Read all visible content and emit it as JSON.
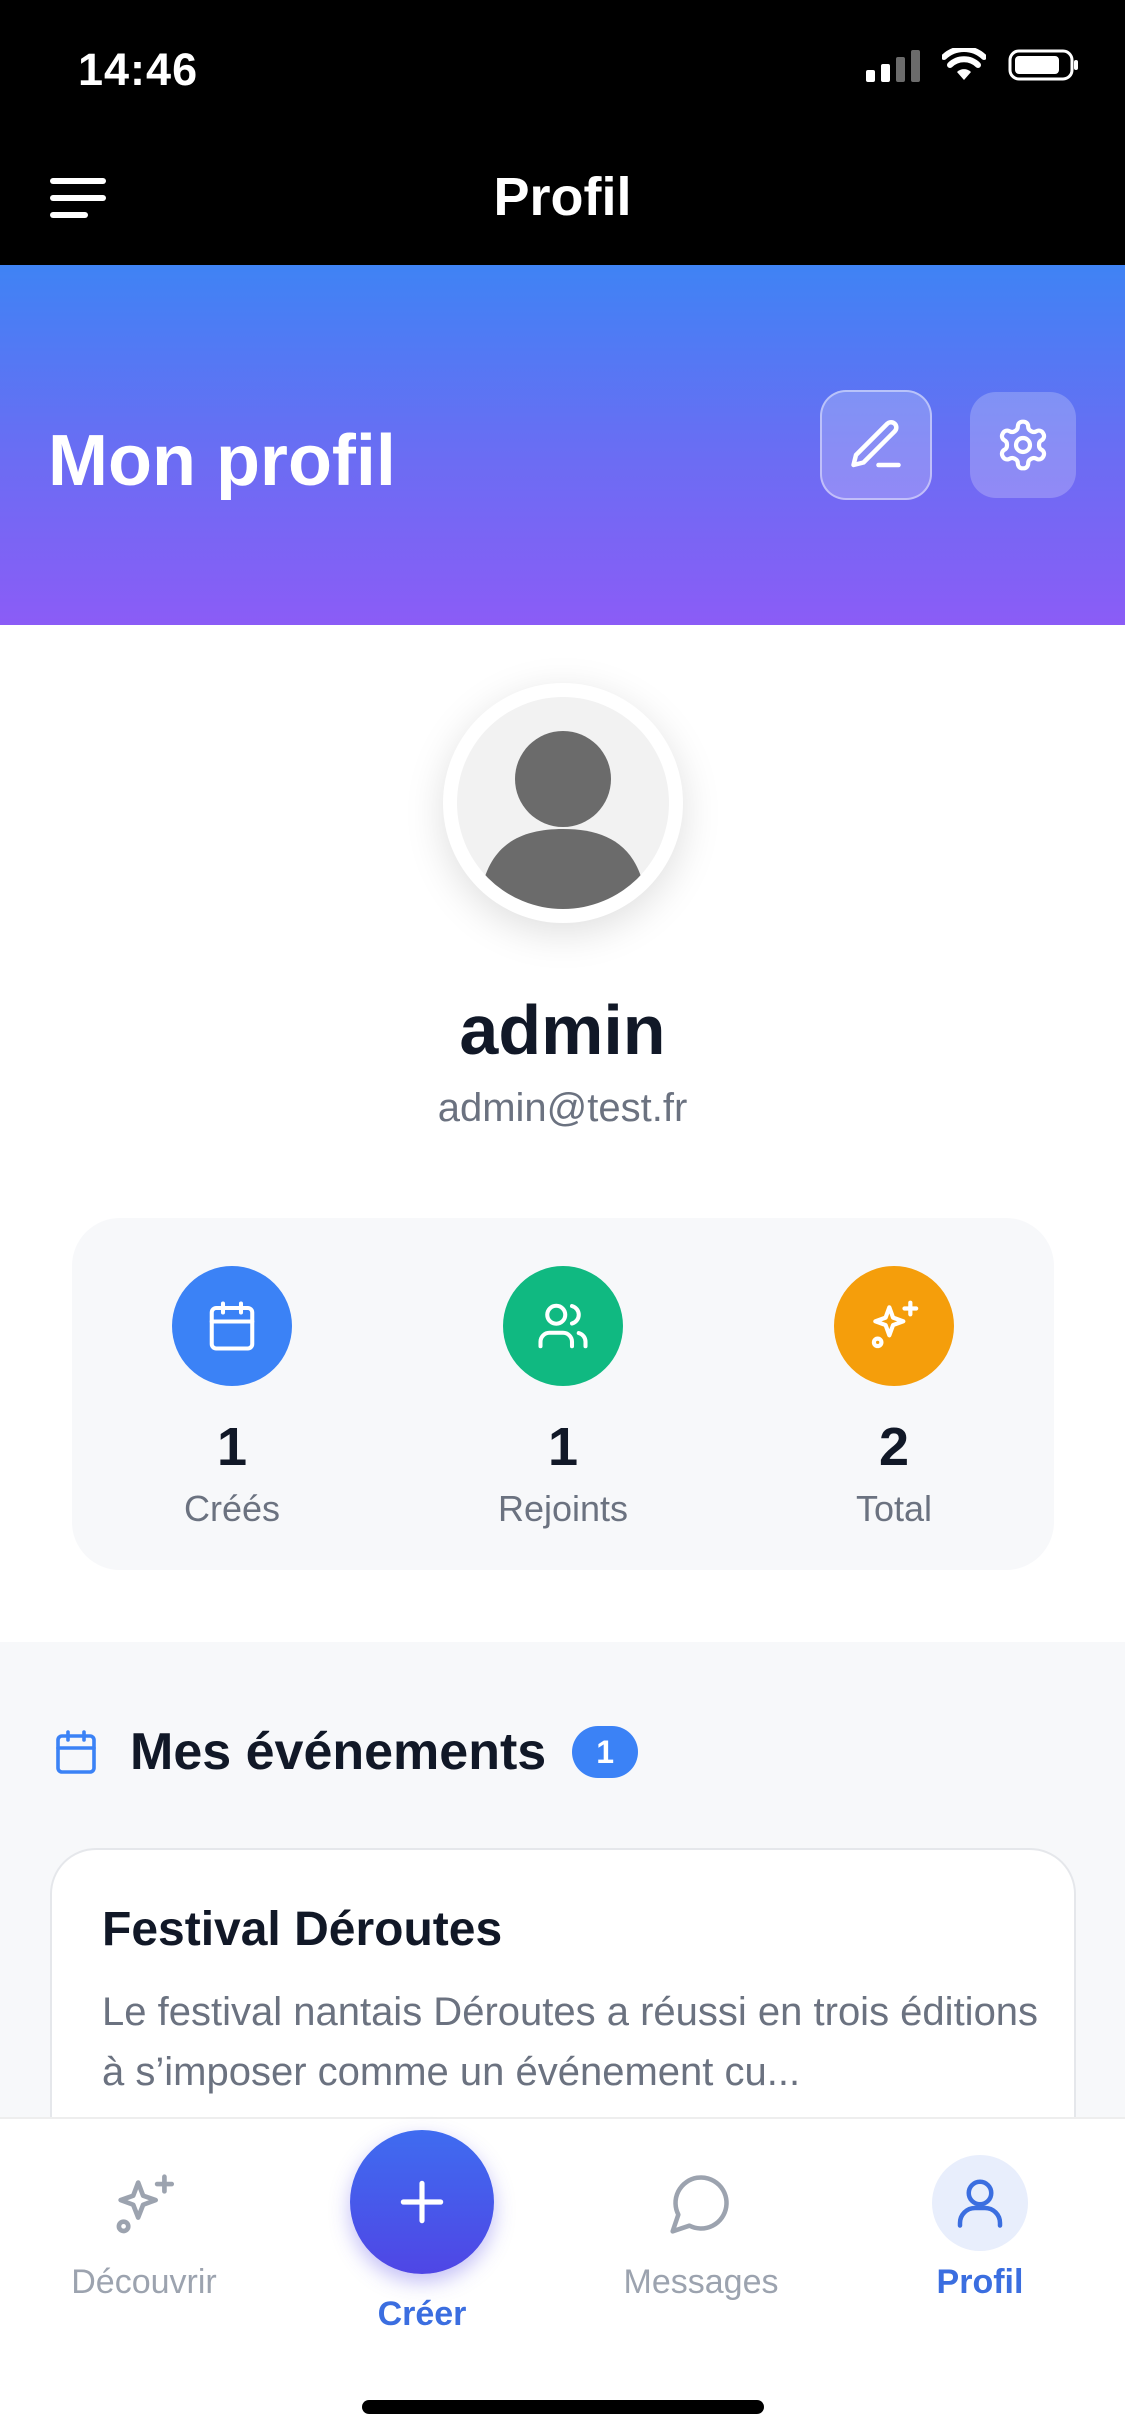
{
  "status_bar": {
    "time": "14:46"
  },
  "nav": {
    "title": "Profil"
  },
  "header": {
    "title": "Mon profil"
  },
  "user": {
    "name": "admin",
    "email": "admin@test.fr"
  },
  "stats": [
    {
      "value": "1",
      "label": "Créés",
      "icon": "calendar-icon",
      "color": "#3b82f6"
    },
    {
      "value": "1",
      "label": "Rejoints",
      "icon": "users-icon",
      "color": "#10b981"
    },
    {
      "value": "2",
      "label": "Total",
      "icon": "sparkles-icon",
      "color": "#f59e0b"
    }
  ],
  "events": {
    "title": "Mes événements",
    "count": "1",
    "items": [
      {
        "title": "Festival Déroutes",
        "description": "Le festival nantais Déroutes a réussi en trois éditions à s’imposer comme un événement cu..."
      }
    ]
  },
  "tabbar": {
    "discover": "Découvrir",
    "create": "Créer",
    "messages": "Messages",
    "profile": "Profil"
  },
  "colors": {
    "accent": "#3b6ee0",
    "gradient_start": "#3f83f4",
    "gradient_end": "#8b5cf6"
  }
}
